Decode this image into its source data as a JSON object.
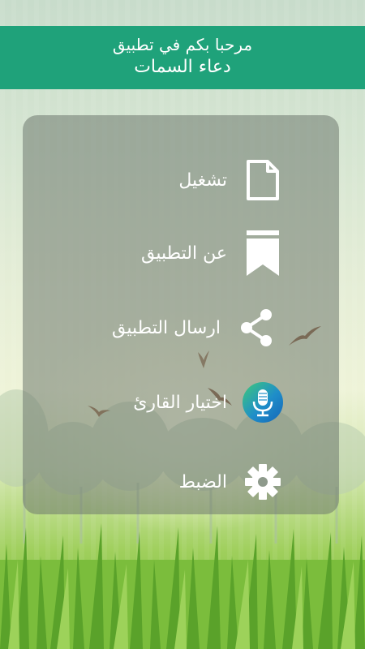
{
  "header": {
    "welcome": "مرحبا بكم في تطبيق",
    "app_name": "دعاء السمات"
  },
  "menu": {
    "items": [
      {
        "label": "تشغيل",
        "icon": "document-icon"
      },
      {
        "label": "عن التطبيق",
        "icon": "bookmark-icon"
      },
      {
        "label": "ارسال التطبيق",
        "icon": "share-icon"
      },
      {
        "label": "اختيار القارئ",
        "icon": "microphone-icon"
      },
      {
        "label": "الضبط",
        "icon": "gear-icon"
      }
    ]
  },
  "colors": {
    "header": "#1fa27a",
    "panel": "#6e786e",
    "text": "#ffffff"
  }
}
